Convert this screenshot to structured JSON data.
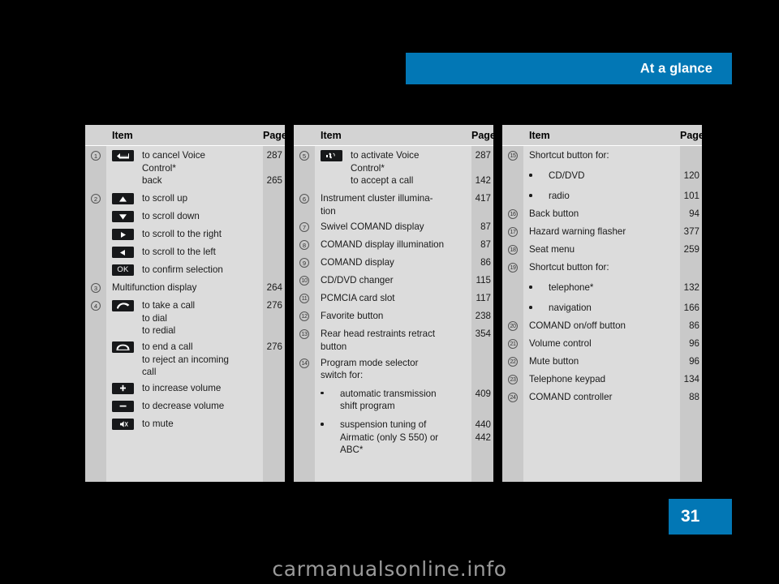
{
  "header": {
    "title": "At a glance",
    "accent_color": "#0277b5"
  },
  "page_number": "31",
  "watermark": "carmanualsonline.info",
  "columns": [
    {
      "headers": {
        "item": "Item",
        "page": "Page"
      },
      "rows": [
        {
          "num": "1",
          "icon": "back-arrow-icon",
          "lines": [
            "to cancel Voice",
            "Control*"
          ],
          "page": "287"
        },
        {
          "num": "",
          "icon": "",
          "lines": [
            "back"
          ],
          "page": "265"
        },
        {
          "num": "2",
          "icon": "up-triangle-icon",
          "lines": [
            "to scroll up"
          ],
          "page": ""
        },
        {
          "num": "",
          "icon": "down-triangle-icon",
          "lines": [
            "to scroll down"
          ],
          "page": ""
        },
        {
          "num": "",
          "icon": "right-triangle-icon",
          "lines": [
            "to scroll to the right"
          ],
          "page": ""
        },
        {
          "num": "",
          "icon": "left-triangle-icon",
          "lines": [
            "to scroll to the left"
          ],
          "page": ""
        },
        {
          "num": "",
          "icon": "ok-icon",
          "lines": [
            "to confirm selection"
          ],
          "page": ""
        },
        {
          "num": "3",
          "icon": "",
          "lines": [
            "Multifunction display"
          ],
          "page": "264"
        },
        {
          "num": "4",
          "icon": "phone-offhook-icon",
          "lines": [
            "to take a call",
            "to dial",
            "to redial"
          ],
          "page": "276"
        },
        {
          "num": "",
          "icon": "phone-onhook-icon",
          "lines": [
            "to end a call",
            "to reject an incoming",
            "call"
          ],
          "page": "276"
        },
        {
          "num": "",
          "icon": "plus-icon",
          "lines": [
            "to increase volume"
          ],
          "page": ""
        },
        {
          "num": "",
          "icon": "minus-icon",
          "lines": [
            "to decrease volume"
          ],
          "page": ""
        },
        {
          "num": "",
          "icon": "mute-speaker-icon",
          "lines": [
            "to mute"
          ],
          "page": ""
        }
      ]
    },
    {
      "headers": {
        "item": "Item",
        "page": "Page"
      },
      "rows": [
        {
          "num": "5",
          "icon": "voice-control-icon",
          "lines": [
            "to activate Voice",
            "Control*"
          ],
          "page": "287"
        },
        {
          "num": "",
          "icon": "",
          "lines": [
            "to accept a call"
          ],
          "page": "142"
        },
        {
          "num": "6",
          "icon": "",
          "lines": [
            "Instrument cluster illumina-",
            "tion"
          ],
          "page": "417"
        },
        {
          "num": "7",
          "icon": "",
          "lines": [
            "Swivel COMAND display"
          ],
          "page": "87"
        },
        {
          "num": "8",
          "icon": "",
          "lines": [
            "COMAND display illumination"
          ],
          "page": "87"
        },
        {
          "num": "9",
          "icon": "",
          "lines": [
            "COMAND display"
          ],
          "page": "86"
        },
        {
          "num": "10",
          "icon": "",
          "lines": [
            "CD/DVD changer"
          ],
          "page": "115"
        },
        {
          "num": "11",
          "icon": "",
          "lines": [
            "PCMCIA card slot"
          ],
          "page": "117"
        },
        {
          "num": "12",
          "icon": "",
          "lines": [
            "Favorite button"
          ],
          "page": "238"
        },
        {
          "num": "13",
          "icon": "",
          "lines": [
            "Rear head restraints retract",
            "button"
          ],
          "page": "354"
        },
        {
          "num": "14",
          "icon": "",
          "lines": [
            "Program mode selector",
            "switch for:"
          ],
          "page": ""
        },
        {
          "num": "",
          "bullet": true,
          "lines": [
            "automatic transmission",
            "shift program"
          ],
          "page": "409"
        },
        {
          "num": "",
          "bullet": true,
          "lines": [
            "suspension tuning of",
            "Airmatic (only S 550) or",
            "ABC*"
          ],
          "page": "440",
          "page2": "442"
        }
      ]
    },
    {
      "headers": {
        "item": "Item",
        "page": "Page"
      },
      "rows": [
        {
          "num": "15",
          "icon": "",
          "lines": [
            "Shortcut button for:"
          ],
          "page": ""
        },
        {
          "num": "",
          "bullet": true,
          "lines": [
            "CD/DVD"
          ],
          "page": "120"
        },
        {
          "num": "",
          "bullet": true,
          "lines": [
            "radio"
          ],
          "page": "101"
        },
        {
          "num": "16",
          "icon": "",
          "lines": [
            "Back button"
          ],
          "page": "94"
        },
        {
          "num": "17",
          "icon": "",
          "lines": [
            "Hazard warning flasher"
          ],
          "page": "377"
        },
        {
          "num": "18",
          "icon": "",
          "lines": [
            "Seat menu"
          ],
          "page": "259"
        },
        {
          "num": "19",
          "icon": "",
          "lines": [
            "Shortcut button for:"
          ],
          "page": ""
        },
        {
          "num": "",
          "bullet": true,
          "lines": [
            "telephone*"
          ],
          "page": "132"
        },
        {
          "num": "",
          "bullet": true,
          "lines": [
            "navigation"
          ],
          "page": "166"
        },
        {
          "num": "20",
          "icon": "",
          "lines": [
            "COMAND on/off button"
          ],
          "page": "86"
        },
        {
          "num": "21",
          "icon": "",
          "lines": [
            "Volume control"
          ],
          "page": "96"
        },
        {
          "num": "22",
          "icon": "",
          "lines": [
            "Mute button"
          ],
          "page": "96"
        },
        {
          "num": "23",
          "icon": "",
          "lines": [
            "Telephone keypad"
          ],
          "page": "134"
        },
        {
          "num": "24",
          "icon": "",
          "lines": [
            "COMAND controller"
          ],
          "page": "88"
        }
      ]
    }
  ]
}
